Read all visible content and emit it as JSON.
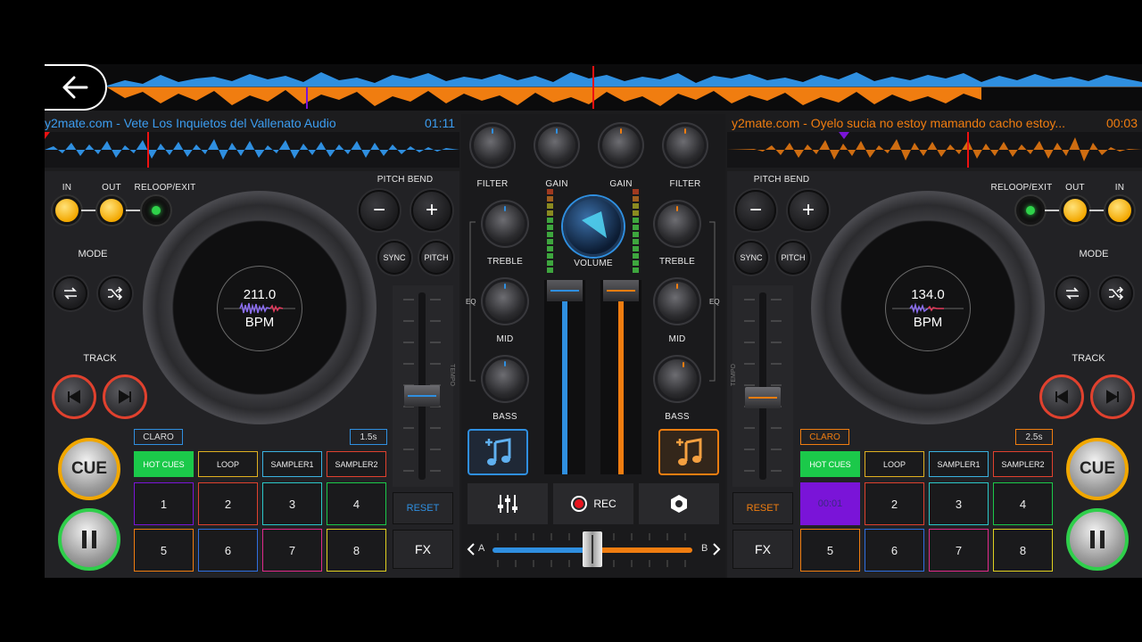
{
  "colors": {
    "blue": "#2f8fe0",
    "orange": "#f07d10",
    "green": "#1bc94a",
    "purple": "#7a14d8",
    "red": "#e0412e",
    "yellow": "#f2a900"
  },
  "left_deck": {
    "title": "y2mate.com - Vete  Los Inquietos del Vallenato Audio",
    "time": "01:11",
    "in_label": "IN",
    "out_label": "OUT",
    "reloop_label": "RELOOP/EXIT",
    "pitch_bend_label": "PITCH BEND",
    "minus": "−",
    "plus": "+",
    "sync_label": "SYNC",
    "pitch_label": "PITCH",
    "mode_label": "MODE",
    "track_label": "TRACK",
    "bpm_value": "211.0",
    "bpm_label": "BPM",
    "claro_label": "CLARO",
    "time_chip": "1.5s",
    "tabs": [
      "HOT CUES",
      "LOOP",
      "SAMPLER1",
      "SAMPLER2"
    ],
    "pads": [
      "1",
      "2",
      "3",
      "4",
      "5",
      "6",
      "7",
      "8"
    ],
    "cue_label": "CUE",
    "reset_label": "RESET",
    "fx_label": "FX",
    "tempo_label": "TEMPO"
  },
  "right_deck": {
    "title": "y2mate.com - Oyelo sucia no estoy mamando cacho estoy...",
    "time": "00:03",
    "in_label": "IN",
    "out_label": "OUT",
    "reloop_label": "RELOOP/EXIT",
    "pitch_bend_label": "PITCH BEND",
    "minus": "−",
    "plus": "+",
    "sync_label": "SYNC",
    "pitch_label": "PITCH",
    "mode_label": "MODE",
    "track_label": "TRACK",
    "bpm_value": "134.0",
    "bpm_label": "BPM",
    "claro_label": "CLARO",
    "time_chip": "2.5s",
    "tabs": [
      "HOT CUES",
      "LOOP",
      "SAMPLER1",
      "SAMPLER2"
    ],
    "pads": [
      "00:01",
      "2",
      "3",
      "4",
      "5",
      "6",
      "7",
      "8"
    ],
    "cue_label": "CUE",
    "reset_label": "RESET",
    "fx_label": "FX",
    "tempo_label": "TEMPO"
  },
  "mixer": {
    "filter_label": "FILTER",
    "gain_label": "GAIN",
    "treble_label": "TREBLE",
    "mid_label": "MID",
    "bass_label": "BASS",
    "volume_label": "VOLUME",
    "eq_label": "EQ",
    "rec_label": "REC",
    "crossfader_a": "A",
    "crossfader_b": "B"
  },
  "icons": [
    "back-arrow-icon",
    "repeat-icon",
    "shuffle-icon",
    "prev-track-icon",
    "next-track-icon",
    "pause-icon",
    "add-music-icon",
    "equalizer-icon",
    "record-icon",
    "settings-icon",
    "chevron-left-icon",
    "chevron-right-icon"
  ]
}
